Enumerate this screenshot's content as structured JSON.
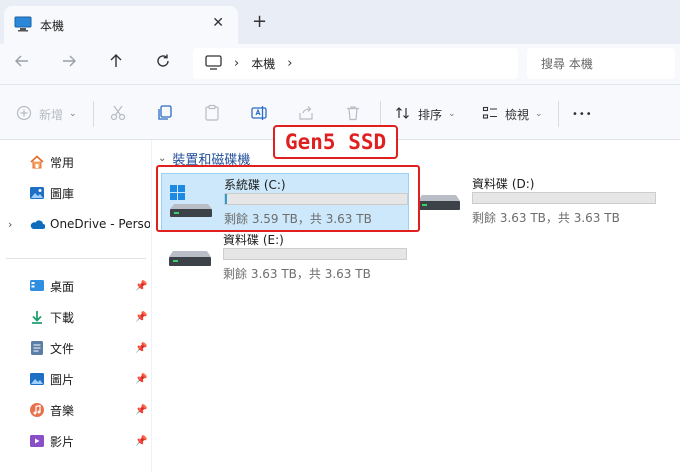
{
  "window": {
    "tab_title": "本機",
    "close_glyph": "✕",
    "newtab_glyph": "+"
  },
  "address": {
    "crumb": "本機",
    "search_placeholder": "搜尋 本機"
  },
  "toolbar": {
    "new_label": "新增",
    "sort_label": "排序",
    "view_label": "檢視",
    "more_glyph": "•••"
  },
  "nav": {
    "items": [
      {
        "label": "常用",
        "icon": "home-icon"
      },
      {
        "label": "圖庫",
        "icon": "gallery-icon"
      },
      {
        "label": "OneDrive - Person",
        "icon": "onedrive-icon"
      }
    ],
    "pinned": [
      {
        "label": "桌面",
        "icon": "desktop-icon"
      },
      {
        "label": "下載",
        "icon": "download-icon"
      },
      {
        "label": "文件",
        "icon": "documents-icon"
      },
      {
        "label": "圖片",
        "icon": "pictures-icon"
      },
      {
        "label": "音樂",
        "icon": "music-icon"
      },
      {
        "label": "影片",
        "icon": "videos-icon"
      }
    ]
  },
  "content": {
    "group_title": "裝置和磁碟機",
    "drives": [
      {
        "name": "系統碟 (C:)",
        "free_text": "剩餘 3.59 TB，共 3.63 TB",
        "used_fraction": 0.011,
        "selected": true
      },
      {
        "name": "資料碟 (D:)",
        "free_text": "剩餘 3.63 TB，共 3.63 TB",
        "used_fraction": 0.0,
        "selected": false
      },
      {
        "name": "資料碟 (E:)",
        "free_text": "剩餘 3.63 TB，共 3.63 TB",
        "used_fraction": 0.0,
        "selected": false
      }
    ]
  },
  "annotation": {
    "label": "Gen5 SSD",
    "color": "#e02020"
  },
  "colors": {
    "accent": "#26a0da",
    "selection": "#cce8fa",
    "header_link": "#1f4e9a"
  }
}
